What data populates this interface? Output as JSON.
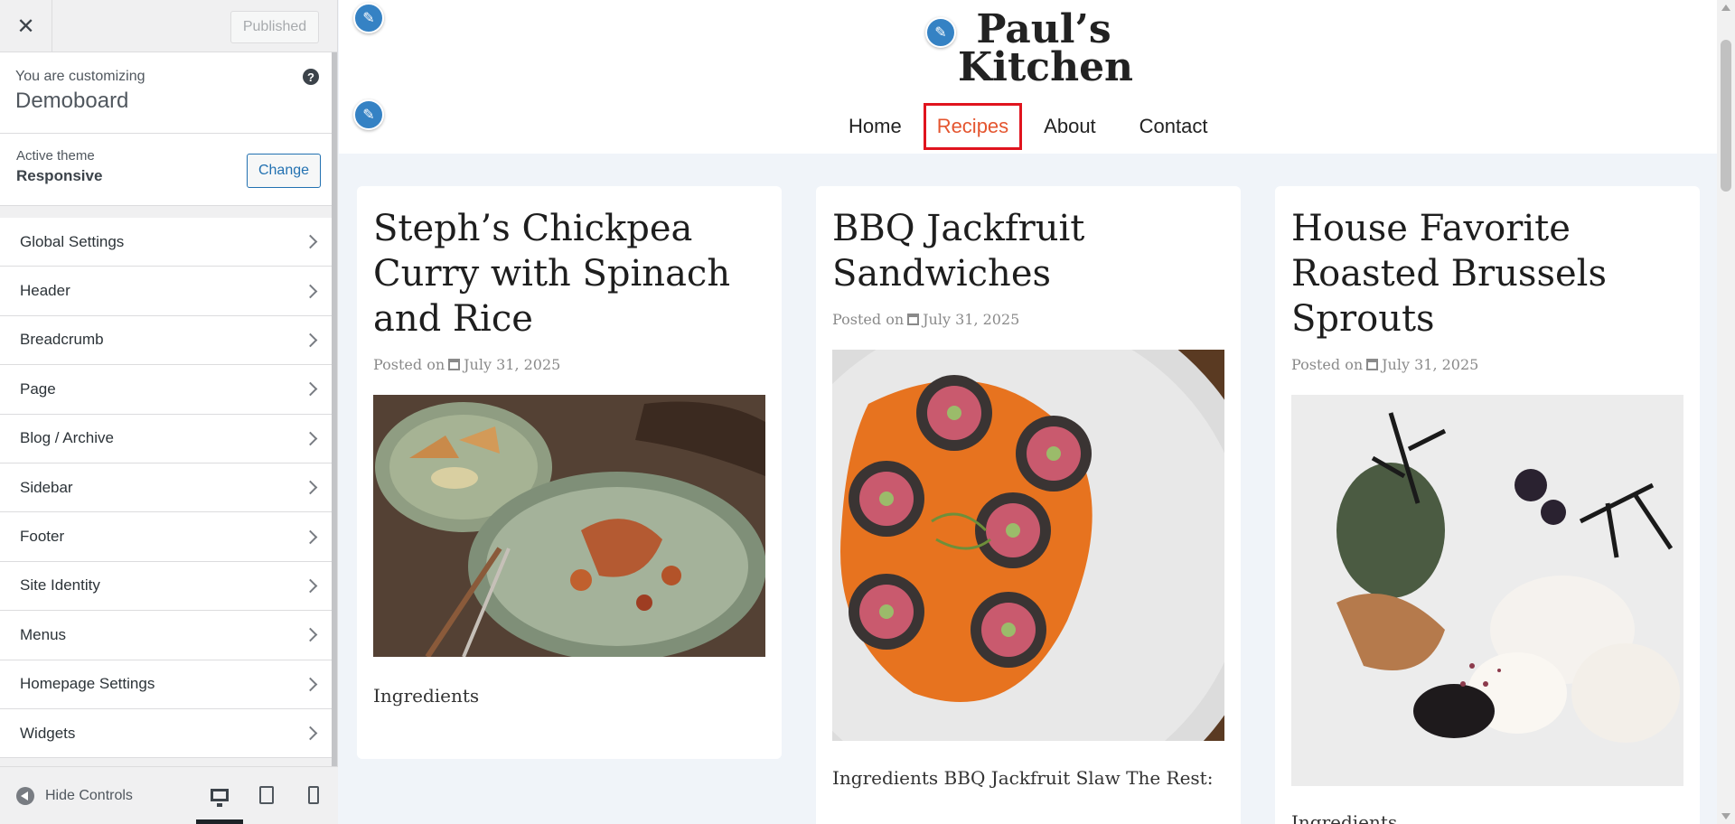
{
  "sidebar": {
    "close_icon": "close-icon",
    "publish_label": "Published",
    "customizing_label": "You are customizing",
    "site_name": "Demoboard",
    "help_icon": "?",
    "active_theme_label": "Active theme",
    "theme_name": "Responsive",
    "change_label": "Change",
    "items": [
      {
        "label": "Global Settings"
      },
      {
        "label": "Header"
      },
      {
        "label": "Breadcrumb"
      },
      {
        "label": "Page"
      },
      {
        "label": "Blog / Archive"
      },
      {
        "label": "Sidebar"
      },
      {
        "label": "Footer"
      },
      {
        "label": "Site Identity"
      },
      {
        "label": "Menus"
      },
      {
        "label": "Homepage Settings"
      },
      {
        "label": "Widgets"
      }
    ],
    "hide_controls_label": "Hide Controls",
    "devices": [
      "desktop",
      "tablet",
      "mobile"
    ]
  },
  "site": {
    "logo_line1": "Paul’s",
    "logo_line2": "Kitchen",
    "nav": [
      {
        "label": "Home"
      },
      {
        "label": "Recipes"
      },
      {
        "label": "About"
      },
      {
        "label": "Contact"
      }
    ],
    "posts": [
      {
        "title": "Steph’s Chickpea Curry with Spinach and Rice",
        "posted_on": "Posted on",
        "date": "July 31, 2025",
        "image_desc": "Plated dish with dumplings, fork and knife on dark wood",
        "excerpt": "Ingredients"
      },
      {
        "title": "BBQ Jackfruit Sandwiches",
        "posted_on": "Posted on",
        "date": "July 31, 2025",
        "image_desc": "Sushi rolls over orange sauce on white plate",
        "excerpt": "Ingredients BBQ Jackfruit Slaw The Rest:"
      },
      {
        "title": "House Favorite Roasted Brussels Sprouts",
        "posted_on": "Posted on",
        "date": "July 31, 2025",
        "image_desc": "Dessert with dark branches, cream and crumble",
        "excerpt": "Ingredients"
      }
    ]
  }
}
